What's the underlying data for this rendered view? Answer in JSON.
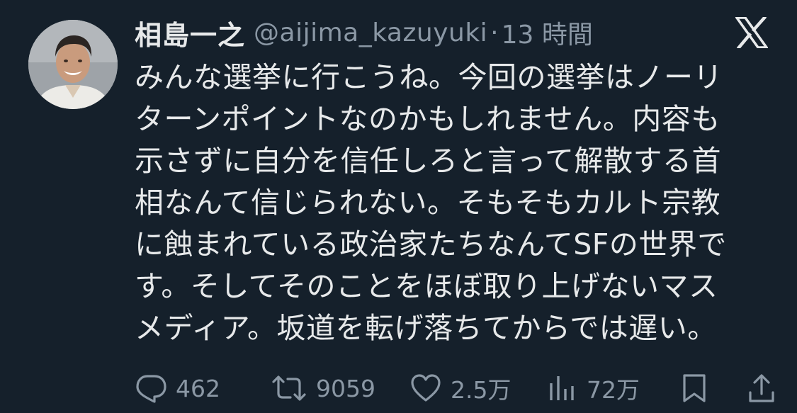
{
  "post": {
    "display_name": "相島一之",
    "handle": "@aijima_kazuyuki",
    "separator": "·",
    "time": "13 時間",
    "body_lines": [
      "みんな選挙に行こうね。今回の選挙はノーリ",
      "ターンポイントなのかもしれません。内容も",
      "示さずに自分を信任しろと言って解散する首",
      "相なんて信じられない。そもそもカルト宗教",
      "に蝕まれている政治家たちなんてSFの世界で",
      "す。そしてそのことをほぼ取り上げないマス",
      "メディア。坂道を転げ落ちてからでは遅い。"
    ]
  },
  "actions": {
    "reply_count": "462",
    "repost_count": "9059",
    "like_count": "2.5万",
    "views_count": "72万"
  },
  "icons": {
    "brand": "x-logo-icon",
    "reply": "reply-icon",
    "repost": "repost-icon",
    "like": "heart-icon",
    "views": "views-icon",
    "bookmark": "bookmark-icon",
    "share": "share-icon"
  },
  "colors": {
    "background": "#15202b",
    "text": "#e7e9ea",
    "muted": "#8b98a5"
  }
}
